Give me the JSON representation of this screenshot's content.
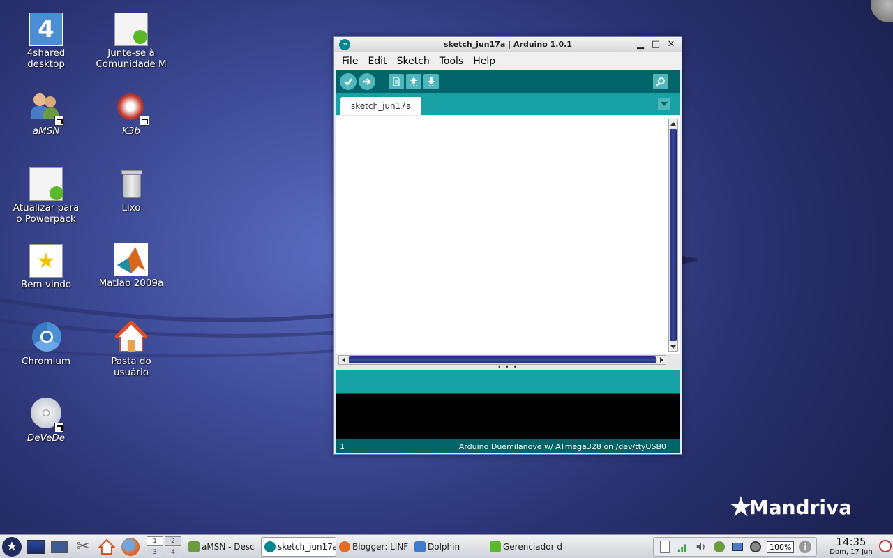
{
  "desktop": {
    "icons": [
      {
        "label": "4shared\ndesktop",
        "italic": false
      },
      {
        "label": "Junte-se à\nComunidade M",
        "italic": false
      },
      {
        "label": "aMSN",
        "italic": true
      },
      {
        "label": "K3b",
        "italic": true
      },
      {
        "label": "Atualizar para\no Powerpack",
        "italic": false
      },
      {
        "label": "Lixo",
        "italic": false
      },
      {
        "label": "Bem-vindo",
        "italic": false
      },
      {
        "label": "Matlab 2009a",
        "italic": false
      },
      {
        "label": "Chromium",
        "italic": false
      },
      {
        "label": "Pasta do\nusuário",
        "italic": false
      },
      {
        "label": "DeVeDe",
        "italic": true
      }
    ],
    "brand": "Mandriva"
  },
  "window": {
    "title": "sketch_jun17a | Arduino 1.0.1",
    "menu": [
      "File",
      "Edit",
      "Sketch",
      "Tools",
      "Help"
    ],
    "tab": "sketch_jun17a",
    "footer_line": "1",
    "footer_board": "Arduino Duemilanove w/ ATmega328 on /dev/ttyUSB0",
    "colors": {
      "toolbar": "#006468",
      "tabbar": "#17a1a5"
    }
  },
  "taskbar": {
    "pager": [
      "1",
      "2",
      "3",
      "4"
    ],
    "tasks": [
      {
        "label": "aMSN - Desc",
        "icon": "amsn-icon"
      },
      {
        "label": "sketch_jun17a",
        "icon": "arduino-icon"
      },
      {
        "label": "Blogger: LINF",
        "icon": "firefox-icon"
      },
      {
        "label": "Dolphin",
        "icon": "dolphin-icon"
      },
      {
        "label": "Gerenciador d",
        "icon": "manager-icon"
      }
    ],
    "battery": "100%",
    "time": "14:35",
    "date": "Dom, 17 Jun"
  }
}
